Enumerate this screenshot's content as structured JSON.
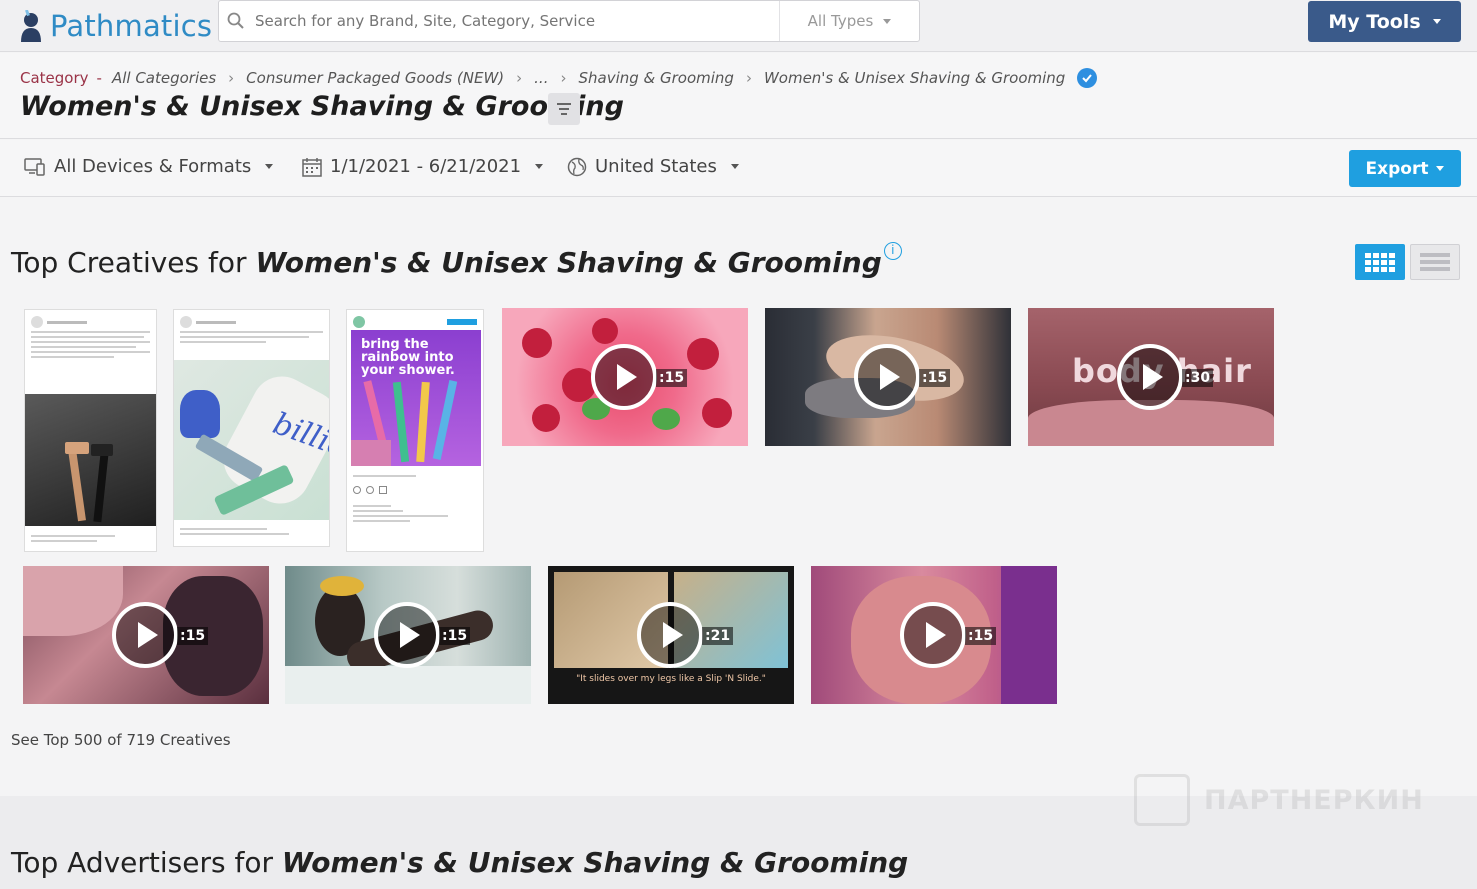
{
  "app": {
    "logo_text": "Pathmatics"
  },
  "search": {
    "placeholder": "Search for any Brand, Site, Category, Service",
    "type_label": "All Types"
  },
  "toolbar": {
    "my_tools_label": "My Tools",
    "export_label": "Export"
  },
  "breadcrumb": {
    "category_label": "Category",
    "dash": "-",
    "items": [
      "All Categories",
      "Consumer Packaged Goods (NEW)",
      "...",
      "Shaving & Grooming",
      "Women's & Unisex Shaving & Grooming"
    ]
  },
  "page": {
    "title": "Women's & Unisex Shaving & Grooming"
  },
  "filters": {
    "devices": "All Devices & Formats",
    "date_range": "1/1/2021 - 6/21/2021",
    "country": "United States"
  },
  "top_creatives": {
    "title_prefix": "Top Creatives for",
    "title_em": "Women's & Unisex Shaving & Grooming",
    "info_glyph": "i",
    "see_more": "See Top 500 of 719 Creatives",
    "creatives": [
      {
        "kind": "social-post",
        "headline": ""
      },
      {
        "kind": "social-post",
        "headline": ""
      },
      {
        "kind": "social-post",
        "headline": "bring the rainbow into your shower."
      },
      {
        "kind": "video",
        "duration": ":15"
      },
      {
        "kind": "video",
        "duration": ":15"
      },
      {
        "kind": "video",
        "duration": ":30",
        "overlay": "body hair"
      },
      {
        "kind": "video",
        "duration": ":15"
      },
      {
        "kind": "video",
        "duration": ":15"
      },
      {
        "kind": "video",
        "duration": ":21",
        "caption": "\"It slides over my legs like a Slip 'N Slide.\""
      },
      {
        "kind": "video",
        "duration": ":15"
      }
    ]
  },
  "top_advertisers": {
    "title_prefix": "Top Advertisers for",
    "title_em": "Women's & Unisex Shaving & Grooming"
  },
  "watermark": {
    "text": "ПАРТНЕРКИН"
  },
  "colors": {
    "brand": "#2f8bc5",
    "accent": "#1f9fe0",
    "tools": "#3a5a8a",
    "category": "#9a3347"
  }
}
